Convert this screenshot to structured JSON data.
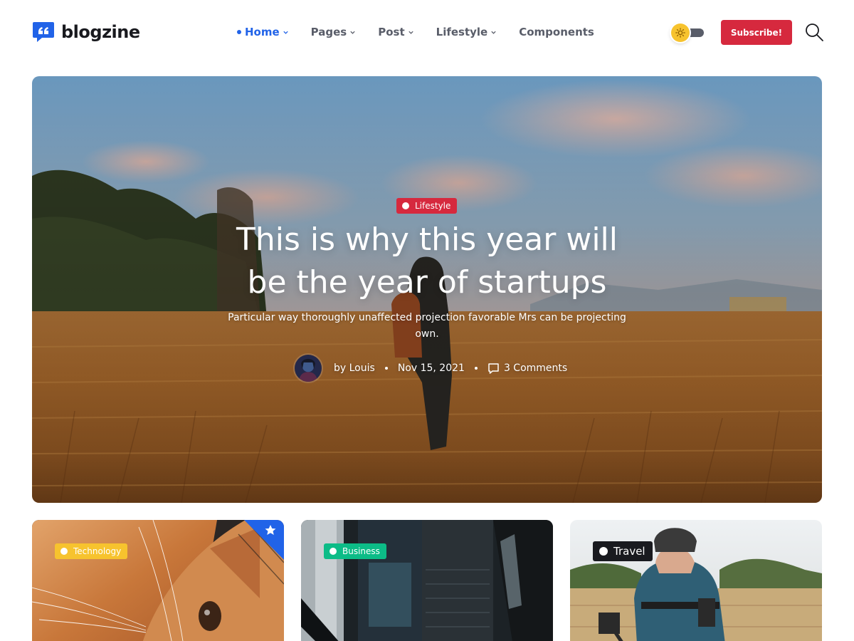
{
  "brand": {
    "name": "blogzine"
  },
  "nav": {
    "items": [
      {
        "label": "Home",
        "active": true,
        "dropdown": true
      },
      {
        "label": "Pages",
        "active": false,
        "dropdown": true
      },
      {
        "label": "Post",
        "active": false,
        "dropdown": true
      },
      {
        "label": "Lifestyle",
        "active": false,
        "dropdown": true
      },
      {
        "label": "Components",
        "active": false,
        "dropdown": false
      }
    ]
  },
  "header": {
    "theme_toggle": {
      "icon": "sun-icon",
      "state": "light"
    },
    "subscribe_label": "Subscribe!",
    "search_icon": "search-icon"
  },
  "hero": {
    "category": "Lifestyle",
    "title_line1": "This is why this year will",
    "title_line2": "be the year of startups",
    "subtitle": "Particular way thoroughly unaffected projection favorable Mrs can be projecting own.",
    "author": "by Louis",
    "date": "Nov 15, 2021",
    "comments": "3 Comments"
  },
  "cards": [
    {
      "category": "Technology",
      "featured": true
    },
    {
      "category": "Business",
      "featured": false
    },
    {
      "category": "Travel",
      "featured": false
    }
  ],
  "colors": {
    "primary": "#2163e8",
    "danger": "#d6293e",
    "warning": "#f7c32e",
    "success": "#0cbc87",
    "dark": "#191a1f",
    "nav_text": "#595d69"
  }
}
